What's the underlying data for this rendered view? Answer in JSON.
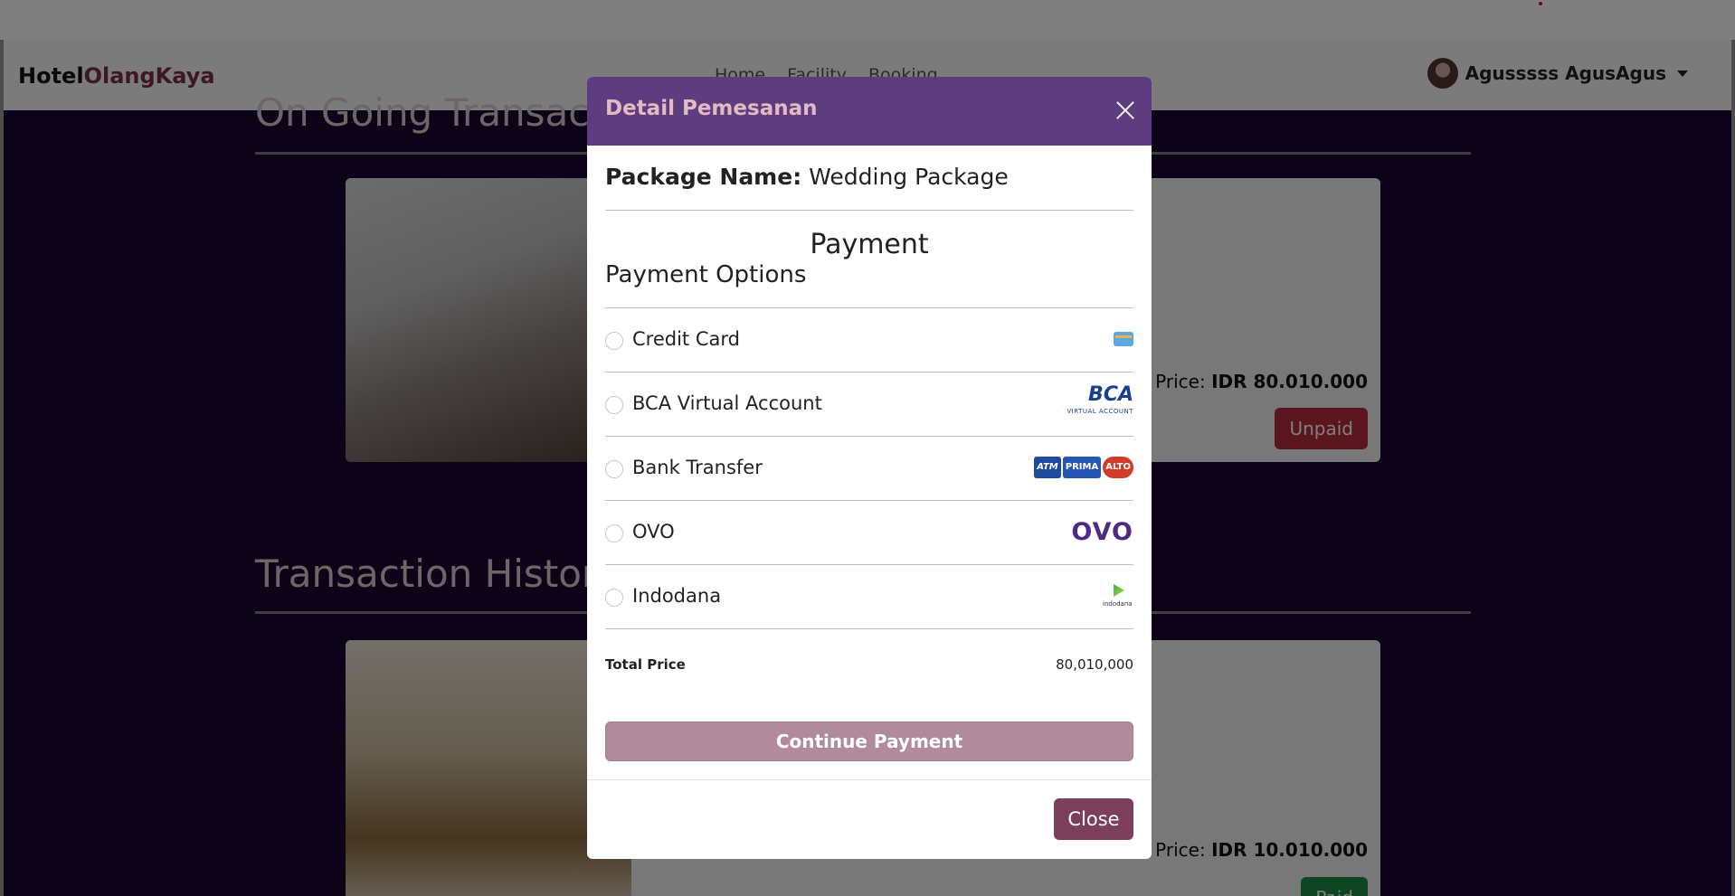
{
  "navbar": {
    "brand_first": "Hotel",
    "brand_second": "OlangKaya",
    "links": [
      "Home",
      "Facility",
      "Booking"
    ],
    "user_name": "Agusssss AgusAgus"
  },
  "ongoing": {
    "title": "On Going Transaction",
    "total_price": "Total Price:",
    "amount": "IDR 80.010.000",
    "status": "Unpaid"
  },
  "history": {
    "title": "Transaction History",
    "total_price": "Total Price:",
    "amount": "IDR 10.010.000",
    "status": "Paid"
  },
  "modal": {
    "title": "Detail Pemesanan",
    "package_label": "Package Name:",
    "package_name": "Wedding Package",
    "payment_heading": "Payment",
    "payment_options_heading": "Payment Options",
    "options": [
      {
        "label": "Credit Card",
        "icon": "credit-card-icon"
      },
      {
        "label": "BCA Virtual Account",
        "icon": "bca-logo"
      },
      {
        "label": "Bank Transfer",
        "icon": "bank-transfer-logos"
      },
      {
        "label": "OVO",
        "icon": "ovo-logo"
      },
      {
        "label": "Indodana",
        "icon": "indodana-logo"
      }
    ],
    "bca_logo_text": "BCA",
    "bca_logo_sub": "VIRTUAL ACCOUNT",
    "bank_logos": [
      "ATM",
      "PRIMA",
      "ALTO"
    ],
    "ovo_logo_text": "OVO",
    "indodana_logo_text": "indodana",
    "total_label": "Total Price",
    "total_value": "80,010,000",
    "continue_label": "Continue Payment",
    "close_label": "Close"
  },
  "colors": {
    "modal_header": "#5d3d80",
    "continue_button": "#b18a9b",
    "close_button": "#7b3f5c",
    "unpaid_badge": "#b72a3c",
    "paid_badge": "#1d8a46"
  }
}
